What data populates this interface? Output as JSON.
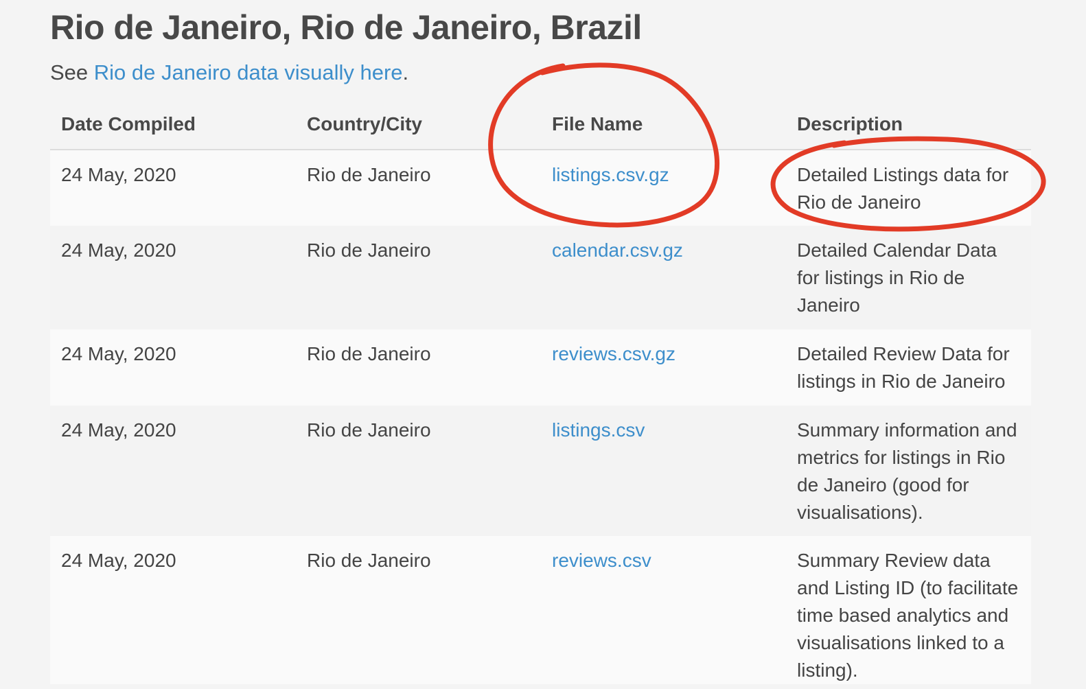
{
  "heading": {
    "title": "Rio de Janeiro, Rio de Janeiro, Brazil",
    "intro_prefix": "See ",
    "intro_link": "Rio de Janeiro data visually here",
    "intro_suffix": "."
  },
  "table": {
    "headers": [
      "Date Compiled",
      "Country/City",
      "File Name",
      "Description"
    ],
    "rows": [
      {
        "date": "24 May, 2020",
        "city": "Rio de Janeiro",
        "file": "listings.csv.gz",
        "description": "Detailed Listings data for Rio de Janeiro"
      },
      {
        "date": "24 May, 2020",
        "city": "Rio de Janeiro",
        "file": "calendar.csv.gz",
        "description": "Detailed Calendar Data for listings in Rio de Janeiro"
      },
      {
        "date": "24 May, 2020",
        "city": "Rio de Janeiro",
        "file": "reviews.csv.gz",
        "description": "Detailed Review Data for listings in Rio de Janeiro"
      },
      {
        "date": "24 May, 2020",
        "city": "Rio de Janeiro",
        "file": "listings.csv",
        "description": "Summary information and metrics for listings in Rio de Janeiro (good for visualisations)."
      },
      {
        "date": "24 May, 2020",
        "city": "Rio de Janeiro",
        "file": "reviews.csv",
        "description": "Summary Review data and Listing ID (to facilitate time based analytics and visualisations linked to a listing)."
      }
    ]
  },
  "colors": {
    "background": "#f4f4f4",
    "text": "#444444",
    "link": "#3d8ecb",
    "annotation": "#e23b26"
  }
}
